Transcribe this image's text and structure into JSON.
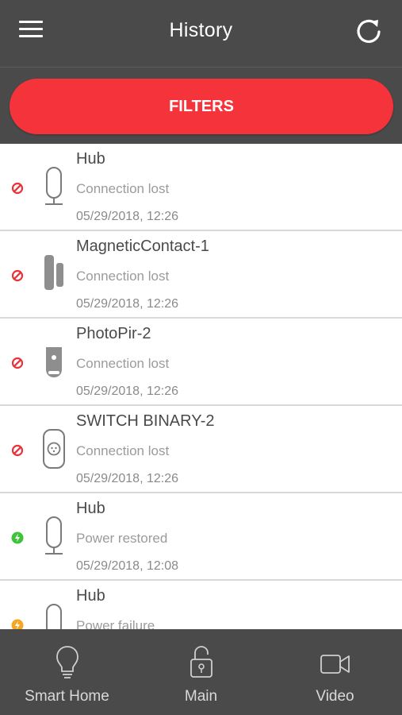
{
  "header": {
    "title": "History"
  },
  "filters": {
    "label": "FILTERS",
    "color": "#f5333a"
  },
  "history": [
    {
      "name": "Hub",
      "event": "Connection lost",
      "time": "05/29/2018, 12:26",
      "status": "connection-lost",
      "device": "hub"
    },
    {
      "name": "MagneticContact-1",
      "event": "Connection lost",
      "time": "05/29/2018, 12:26",
      "status": "connection-lost",
      "device": "magnetic-contact"
    },
    {
      "name": "PhotoPir-2",
      "event": "Connection lost",
      "time": "05/29/2018, 12:26",
      "status": "connection-lost",
      "device": "photo-pir"
    },
    {
      "name": "SWITCH BINARY-2",
      "event": "Connection lost",
      "time": "05/29/2018, 12:26",
      "status": "connection-lost",
      "device": "switch-binary"
    },
    {
      "name": "Hub",
      "event": "Power restored",
      "time": "05/29/2018, 12:08",
      "status": "power-restored",
      "device": "hub"
    },
    {
      "name": "Hub",
      "event": "Power failure",
      "time": "",
      "status": "power-failure",
      "device": "hub"
    }
  ],
  "status_colors": {
    "connection-lost": "#e8333a",
    "power-restored": "#3ec43a",
    "power-failure": "#f5a623"
  },
  "tabs": [
    {
      "label": "Smart Home",
      "icon": "bulb-icon"
    },
    {
      "label": "Main",
      "icon": "lock-open-icon"
    },
    {
      "label": "Video",
      "icon": "video-camera-icon"
    }
  ]
}
